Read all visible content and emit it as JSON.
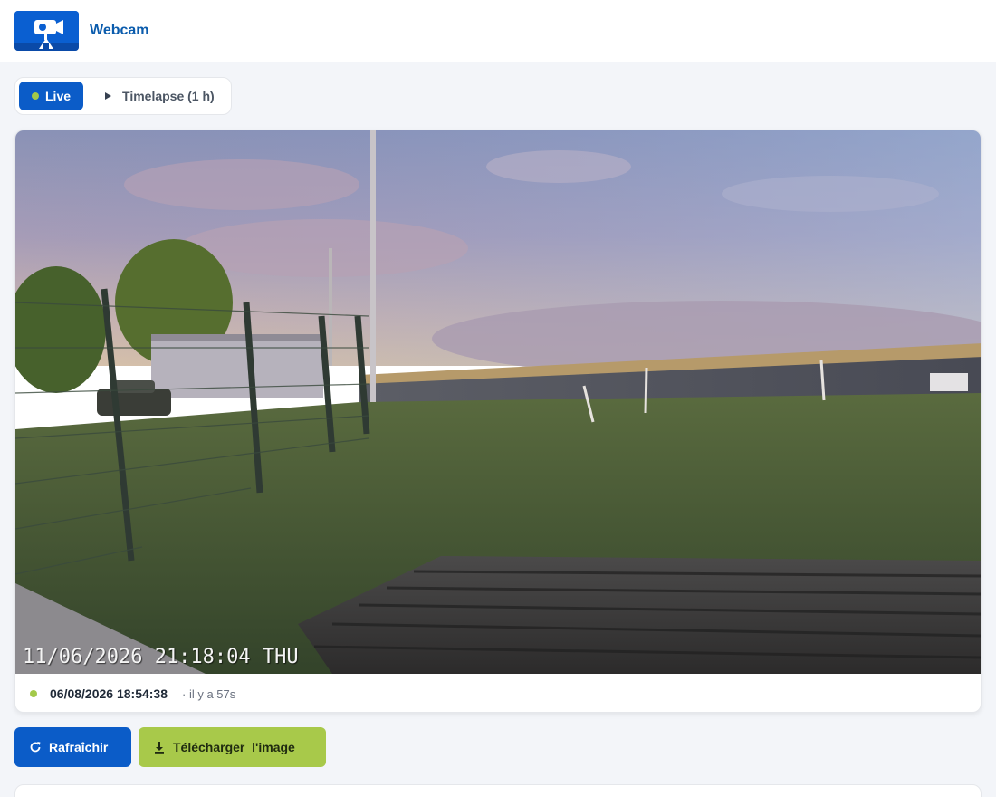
{
  "app": {
    "title": "Webcam",
    "logo_icon": "webcam-camera-icon"
  },
  "tabs": [
    {
      "label": "Live",
      "icon": "live-dot-icon",
      "active": true
    },
    {
      "label": "Timelapse (1 h)",
      "icon": "play-icon",
      "active": false
    }
  ],
  "camera": {
    "overlay_timestamp": "11/06/2026 21:18:04 THU"
  },
  "status": {
    "timestamp": "06/08/2026 18:54:38",
    "relative": "· il y a 57s",
    "indicator_color": "#a3c94a"
  },
  "actions": {
    "refresh_label": "Rafraîchir",
    "refresh_icon": "refresh-icon",
    "download_label": "Télécharger  l'image",
    "download_icon": "download-icon"
  },
  "colors": {
    "primary": "#0b5cc8",
    "accent_green": "#a8c94a",
    "title": "#0b5cad"
  }
}
